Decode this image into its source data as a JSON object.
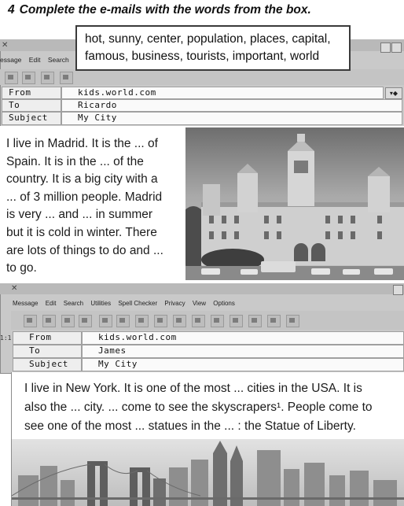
{
  "heading": {
    "number": "4",
    "text": "Complete the e-mails with the words from the box."
  },
  "word_box": {
    "lines": [
      "hot, sunny, center, population, places, capital,",
      "famous, business, tourists, important, world"
    ]
  },
  "email1": {
    "menu": [
      "essage",
      "Edit",
      "Search"
    ],
    "from_label": "From",
    "from_value": "kids.world.com",
    "to_label": "To",
    "to_value": "Ricardo",
    "subject_label": "Subject",
    "subject_value": "My City",
    "body_lines": [
      "I live in Madrid. It is the ... of",
      "Spain. It is in the ... of the",
      "country. It is a big city with a",
      "... of 3 million people. Madrid",
      "is very ... and ... in summer",
      "but it is cold in winter. There",
      "are lots of things to do and ...",
      "to go."
    ]
  },
  "email2": {
    "menu": [
      "Message",
      "Edit",
      "Search",
      "Utilities",
      "Spell Checker",
      "Privacy",
      "View",
      "Options"
    ],
    "side_marker": "1:1",
    "from_label": "From",
    "from_value": "kids.world.com",
    "to_label": "To",
    "to_value": "James",
    "subject_label": "Subject",
    "subject_value": "My City",
    "body_lines": [
      "I live in New York. It is one of the most ... cities in the USA. It is",
      "also the ... city. ... come to see the skyscrapers¹. People come to",
      "see one of the most ... statues in the ... : the Statue of Liberty."
    ]
  }
}
